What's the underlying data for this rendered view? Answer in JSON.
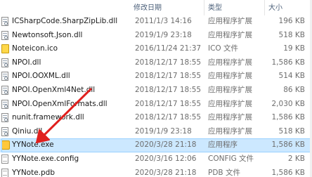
{
  "columns": {
    "name": "",
    "date": "修改日期",
    "type": "类型",
    "size": "大小"
  },
  "files": [
    {
      "name": "ICSharpCode.SharpZipLib.dll",
      "date": "2011/1/3 14:16",
      "type": "应用程序扩展",
      "size": "196 KB",
      "icon": "dll-file-icon"
    },
    {
      "name": "Newtonsoft.Json.dll",
      "date": "2019/1/9 23:18",
      "type": "应用程序扩展",
      "size": "518 KB",
      "icon": "dll-file-icon"
    },
    {
      "name": "Noteicon.ico",
      "date": "2016/11/24 21:37",
      "type": "ICO 文件",
      "size": "19 KB",
      "icon": "ico-file-icon"
    },
    {
      "name": "NPOI.dll",
      "date": "2018/12/17 18:55",
      "type": "应用程序扩展",
      "size": "1,586 KB",
      "icon": "dll-file-icon"
    },
    {
      "name": "NPOI.OOXML.dll",
      "date": "2018/12/17 18:55",
      "type": "应用程序扩展",
      "size": "514 KB",
      "icon": "dll-file-icon"
    },
    {
      "name": "NPOI.OpenXml4Net.dll",
      "date": "2018/12/17 18:55",
      "type": "应用程序扩展",
      "size": "86 KB",
      "icon": "dll-file-icon"
    },
    {
      "name": "NPOI.OpenXmlFormats.dll",
      "date": "2018/12/17 18:55",
      "type": "应用程序扩展",
      "size": "2,030 KB",
      "icon": "dll-file-icon"
    },
    {
      "name": "nunit.framework.dll",
      "date": "2018/12/17 18:55",
      "type": "应用程序扩展",
      "size": "1,586 KB",
      "icon": "dll-file-icon"
    },
    {
      "name": "Qiniu.dll",
      "date": "2019/1/9 23:18",
      "type": "应用程序扩展",
      "size": "518 KB",
      "icon": "dll-file-icon"
    },
    {
      "name": "YYNote.exe",
      "date": "2020/3/28 21:18",
      "type": "应用程序",
      "size": "1,586 KB",
      "icon": "exe-file-icon",
      "selected": true
    },
    {
      "name": "YYNote.exe.config",
      "date": "2020/3/16 12:06",
      "type": "CONFIG 文件",
      "size": "2 KB",
      "icon": "config-file-icon"
    },
    {
      "name": "YYNote.pdb",
      "date": "2020/3/28 21:18",
      "type": "PDB 文件",
      "size": "1,586 KB",
      "icon": "pdb-file-icon"
    }
  ],
  "colors": {
    "selection_bg": "#cce8ff",
    "selection_border": "#99d1ff",
    "arrow": "#e0201e"
  }
}
